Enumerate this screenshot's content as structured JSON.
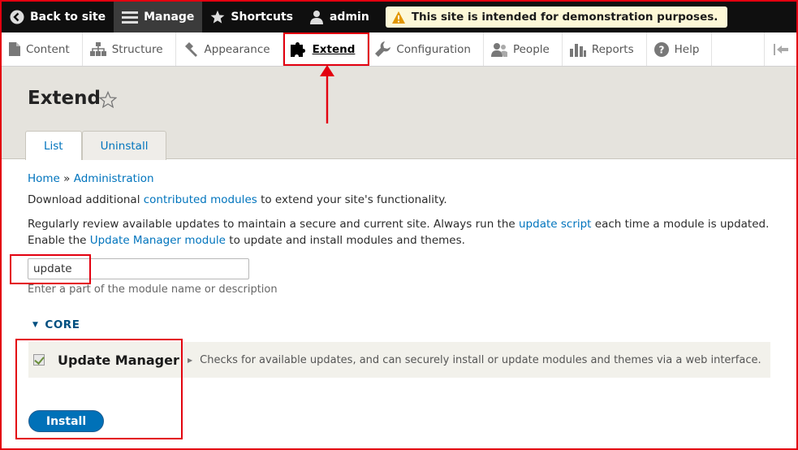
{
  "toolbar": {
    "back_label": "Back to site",
    "manage_label": "Manage",
    "shortcuts_label": "Shortcuts",
    "user_label": "admin",
    "warning_text": "This site is intended for demonstration purposes."
  },
  "tray": {
    "items": [
      {
        "label": "Content",
        "icon": "page-icon"
      },
      {
        "label": "Structure",
        "icon": "structure-icon"
      },
      {
        "label": "Appearance",
        "icon": "paintbrush-icon"
      },
      {
        "label": "Extend",
        "icon": "puzzle-icon"
      },
      {
        "label": "Configuration",
        "icon": "wrench-icon"
      },
      {
        "label": "People",
        "icon": "people-icon"
      },
      {
        "label": "Reports",
        "icon": "bar-chart-icon"
      },
      {
        "label": "Help",
        "icon": "help-icon"
      }
    ],
    "active": "Extend"
  },
  "page": {
    "title": "Extend",
    "tabs": [
      {
        "label": "List"
      },
      {
        "label": "Uninstall"
      }
    ],
    "active_tab": "List"
  },
  "breadcrumb": {
    "home": "Home",
    "sep": "»",
    "admin": "Administration"
  },
  "intro": {
    "download_pre": "Download additional ",
    "download_link": "contributed modules",
    "download_post": " to extend your site's functionality.",
    "review_pre": "Regularly review available updates to maintain a secure and current site. Always run the ",
    "review_link": "update script",
    "review_mid": " each time a module is updated.",
    "enable_pre": "Enable the ",
    "enable_link": "Update Manager module",
    "enable_post": " to update and install modules and themes."
  },
  "filter": {
    "value": "update",
    "description": "Enter a part of the module name or description"
  },
  "group": {
    "label": "CORE"
  },
  "module": {
    "name": "Update Manager",
    "description": "Checks for available updates, and can securely install or update modules and themes via a web interface.",
    "checked": true
  },
  "install_label": "Install",
  "colors": {
    "accent": "#0074bd",
    "annotation": "#e3000f",
    "toolbar": "#0f0f0f"
  }
}
